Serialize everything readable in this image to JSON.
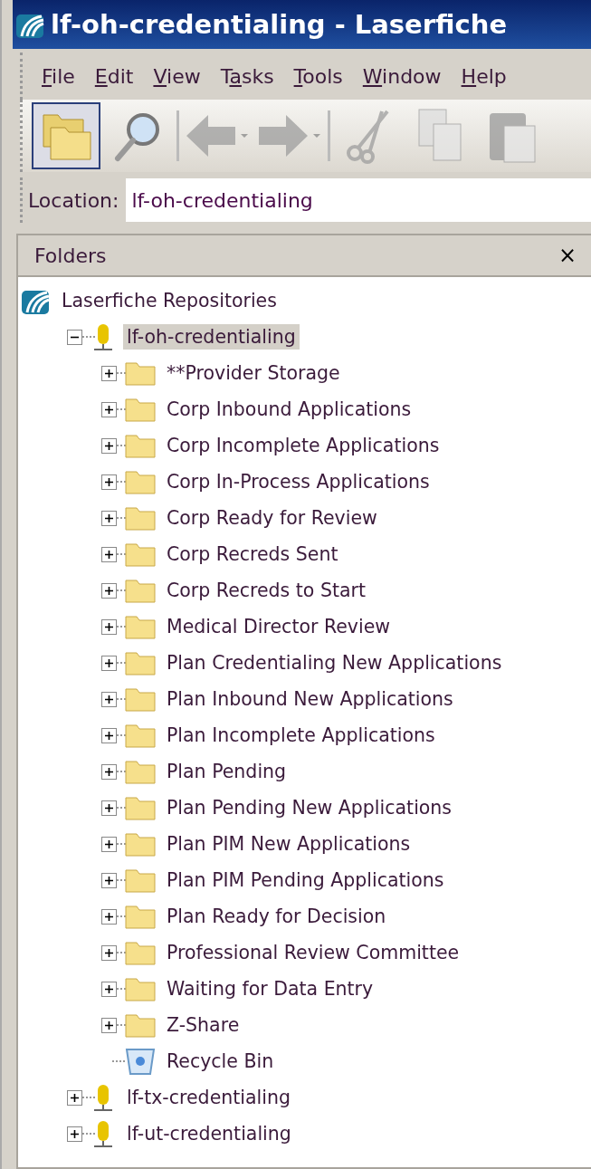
{
  "window": {
    "title": "lf-oh-credentialing - Laserfiche"
  },
  "menu": [
    {
      "access_key": "F",
      "after": "ile"
    },
    {
      "access_key": "E",
      "after": "dit"
    },
    {
      "access_key": "V",
      "after": "iew"
    },
    {
      "before": "T",
      "access_key": "a",
      "after": "sks"
    },
    {
      "access_key": "T",
      "after": "ools"
    },
    {
      "access_key": "W",
      "after": "indow"
    },
    {
      "access_key": "H",
      "after": "elp"
    }
  ],
  "toolbar": [
    {
      "kind": "folders",
      "selected": true,
      "disabled": false
    },
    {
      "kind": "search",
      "selected": false,
      "disabled": false
    },
    {
      "kind": "separator"
    },
    {
      "kind": "back",
      "selected": false,
      "disabled": true
    },
    {
      "kind": "forward",
      "selected": false,
      "disabled": true
    },
    {
      "kind": "separator"
    },
    {
      "kind": "cut",
      "selected": false,
      "disabled": true
    },
    {
      "kind": "copy",
      "selected": false,
      "disabled": true
    },
    {
      "kind": "paste",
      "selected": false,
      "disabled": true
    }
  ],
  "location": {
    "label": "Location:",
    "value": "lf-oh-credentialing"
  },
  "folders_panel": {
    "title": "Folders",
    "close": "×",
    "tree": [
      {
        "kind": "root",
        "label": "Laserfiche Repositories",
        "selected": false,
        "children": [
          {
            "kind": "repository",
            "label": "lf-oh-credentialing",
            "expanded": true,
            "selected": true,
            "children": [
              {
                "kind": "folder",
                "label": "**Provider Storage",
                "expanded": false,
                "selected": false
              },
              {
                "kind": "folder",
                "label": "Corp Inbound Applications",
                "expanded": false,
                "selected": false
              },
              {
                "kind": "folder",
                "label": "Corp Incomplete Applications",
                "expanded": false,
                "selected": false
              },
              {
                "kind": "folder",
                "label": "Corp In-Process Applications",
                "expanded": false,
                "selected": false
              },
              {
                "kind": "folder",
                "label": "Corp Ready for Review",
                "expanded": false,
                "selected": false
              },
              {
                "kind": "folder",
                "label": "Corp Recreds Sent",
                "expanded": false,
                "selected": false
              },
              {
                "kind": "folder",
                "label": "Corp Recreds to Start",
                "expanded": false,
                "selected": false
              },
              {
                "kind": "folder",
                "label": "Medical Director Review",
                "expanded": false,
                "selected": false
              },
              {
                "kind": "folder",
                "label": "Plan Credentialing New Applications",
                "expanded": false,
                "selected": false
              },
              {
                "kind": "folder",
                "label": "Plan Inbound New Applications",
                "expanded": false,
                "selected": false
              },
              {
                "kind": "folder",
                "label": "Plan Incomplete Applications",
                "expanded": false,
                "selected": false
              },
              {
                "kind": "folder",
                "label": "Plan Pending",
                "expanded": false,
                "selected": false
              },
              {
                "kind": "folder",
                "label": "Plan Pending New Applications",
                "expanded": false,
                "selected": false
              },
              {
                "kind": "folder",
                "label": "Plan PIM New Applications",
                "expanded": false,
                "selected": false
              },
              {
                "kind": "folder",
                "label": "Plan PIM Pending Applications",
                "expanded": false,
                "selected": false
              },
              {
                "kind": "folder",
                "label": "Plan Ready for Decision",
                "expanded": false,
                "selected": false
              },
              {
                "kind": "folder",
                "label": "Professional Review Committee",
                "expanded": false,
                "selected": false
              },
              {
                "kind": "folder",
                "label": "Waiting for Data Entry",
                "expanded": false,
                "selected": false
              },
              {
                "kind": "folder",
                "label": "Z-Share",
                "expanded": false,
                "selected": false
              },
              {
                "kind": "recycle-bin",
                "label": "Recycle Bin",
                "selected": false
              }
            ]
          },
          {
            "kind": "repository",
            "label": "lf-tx-credentialing",
            "expanded": false,
            "selected": false
          },
          {
            "kind": "repository",
            "label": "lf-ut-credentialing",
            "expanded": false,
            "selected": false
          }
        ]
      }
    ]
  }
}
